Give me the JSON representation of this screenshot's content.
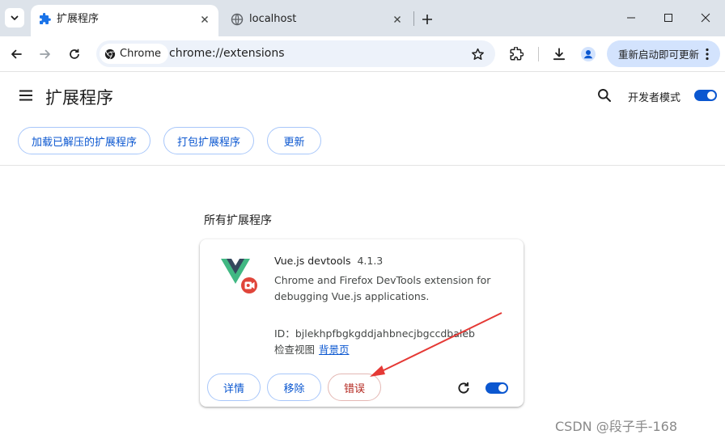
{
  "browser": {
    "tabs": [
      {
        "title": "扩展程序",
        "icon": "puzzle-icon",
        "active": true
      },
      {
        "title": "localhost",
        "icon": "globe-icon",
        "active": false
      }
    ],
    "omnibox": {
      "chip_label": "Chrome",
      "url": "chrome://extensions"
    },
    "relaunch_label": "重新启动即可更新"
  },
  "page": {
    "title": "扩展程序",
    "developer_mode_label": "开发者模式",
    "developer_mode_on": true,
    "actions": {
      "load_unpacked": "加载已解压的扩展程序",
      "pack": "打包扩展程序",
      "update": "更新"
    },
    "section_title": "所有扩展程序"
  },
  "extension": {
    "name": "Vue.js devtools",
    "version": "4.1.3",
    "description": "Chrome and Firefox DevTools extension for debugging Vue.js applications.",
    "id_label": "ID：",
    "id": "bjlekhpfbgkgddjahbnecjbgccdbaleb",
    "views_label": "检查视图",
    "views_link": "背景页",
    "buttons": {
      "details": "详情",
      "remove": "移除",
      "errors": "错误"
    },
    "enabled": true
  },
  "colors": {
    "accent": "#0b57d0",
    "error": "#b3261e",
    "annotation_arrow": "#e53935"
  },
  "watermark": "CSDN @段子手-168"
}
